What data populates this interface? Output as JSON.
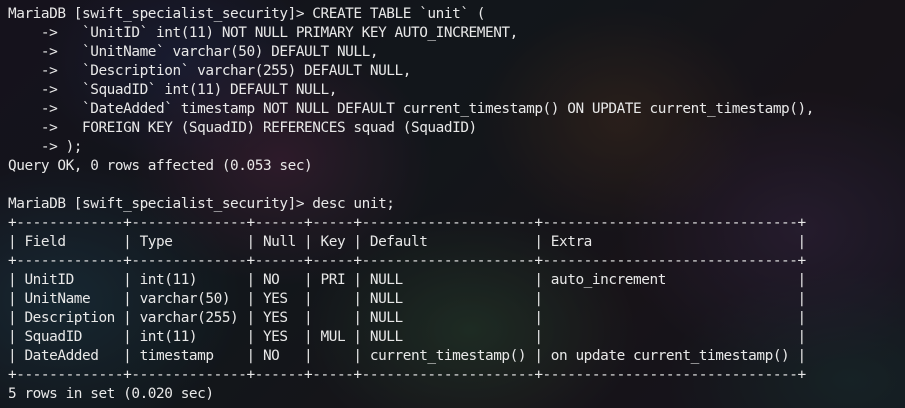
{
  "terminal": {
    "lines": [
      "MariaDB [swift_specialist_security]> CREATE TABLE `unit` (",
      "    ->   `UnitID` int(11) NOT NULL PRIMARY KEY AUTO_INCREMENT,",
      "    ->   `UnitName` varchar(50) DEFAULT NULL,",
      "    ->   `Description` varchar(255) DEFAULT NULL,",
      "    ->   `SquadID` int(11) DEFAULT NULL,",
      "    ->   `DateAdded` timestamp NOT NULL DEFAULT current_timestamp() ON UPDATE current_timestamp(),",
      "    ->   FOREIGN KEY (SquadID) REFERENCES squad (SquadID)",
      "    -> );",
      "Query OK, 0 rows affected (0.053 sec)",
      "",
      "MariaDB [swift_specialist_security]> desc unit;",
      "+-------------+--------------+------+-----+---------------------+-------------------------------+",
      "| Field       | Type         | Null | Key | Default             | Extra                         |",
      "+-------------+--------------+------+-----+---------------------+-------------------------------+",
      "| UnitID      | int(11)      | NO   | PRI | NULL                | auto_increment                |",
      "| UnitName    | varchar(50)  | YES  |     | NULL                |                               |",
      "| Description | varchar(255) | YES  |     | NULL                |                               |",
      "| SquadID     | int(11)      | YES  | MUL | NULL                |                               |",
      "| DateAdded   | timestamp    | NO   |     | current_timestamp() | on update current_timestamp() |",
      "+-------------+--------------+------+-----+---------------------+-------------------------------+",
      "5 rows in set (0.020 sec)"
    ]
  }
}
